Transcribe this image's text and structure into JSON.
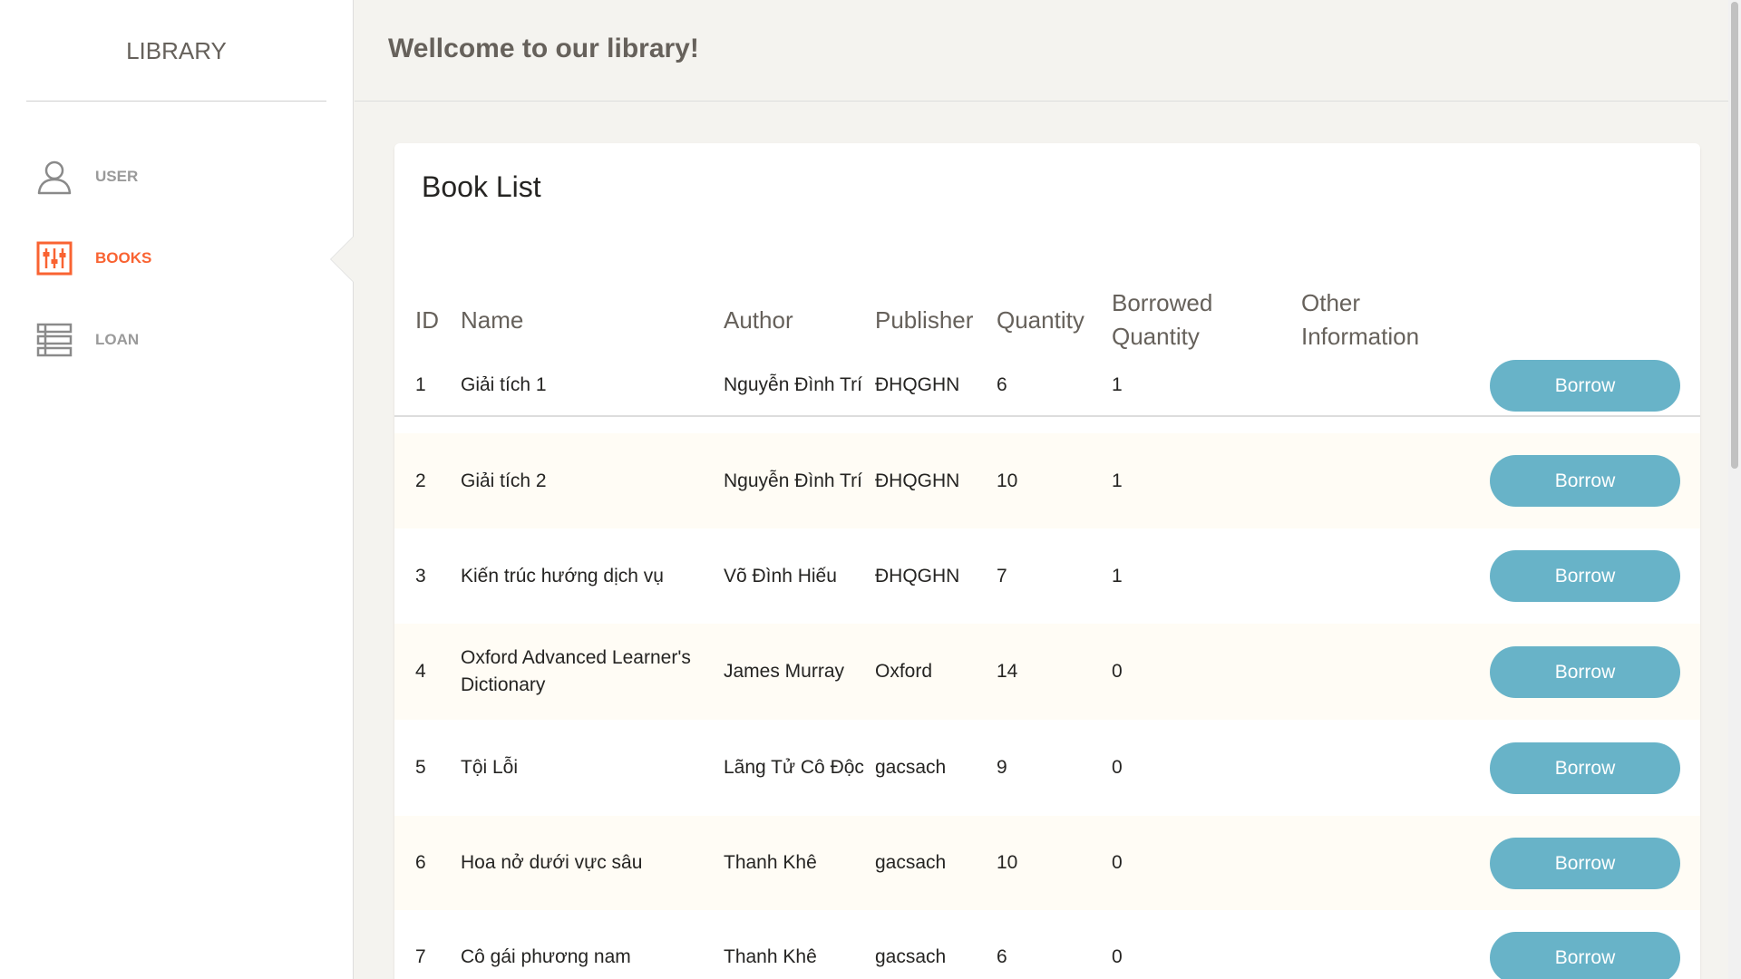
{
  "sidebar": {
    "brand": "LIBRARY",
    "items": [
      {
        "label": "USER",
        "icon": "user-icon",
        "active": false
      },
      {
        "label": "BOOKS",
        "icon": "books-icon",
        "active": true
      },
      {
        "label": "LOAN",
        "icon": "loan-icon",
        "active": false
      }
    ]
  },
  "header": {
    "title": "Wellcome to our library!"
  },
  "book_list": {
    "title": "Book List",
    "columns": [
      "ID",
      "Name",
      "Author",
      "Publisher",
      "Quantity",
      "Borrowed Quantity",
      "Other Information"
    ],
    "action_label": "Borrow",
    "rows": [
      {
        "id": "1",
        "name": "Giải tích 1",
        "author": "Nguyễn Đình Trí",
        "publisher": "ĐHQGHN",
        "quantity": "6",
        "borrowed": "1",
        "other": ""
      },
      {
        "id": "2",
        "name": "Giải tích 2",
        "author": "Nguyễn Đình Trí",
        "publisher": "ĐHQGHN",
        "quantity": "10",
        "borrowed": "1",
        "other": ""
      },
      {
        "id": "3",
        "name": "Kiến trúc hướng dịch vụ",
        "author": "Võ Đình Hiếu",
        "publisher": "ĐHQGHN",
        "quantity": "7",
        "borrowed": "1",
        "other": ""
      },
      {
        "id": "4",
        "name": "Oxford Advanced Learner's Dictionary",
        "author": "James Murray",
        "publisher": "Oxford",
        "quantity": "14",
        "borrowed": "0",
        "other": ""
      },
      {
        "id": "5",
        "name": "Tội Lỗi",
        "author": "Lãng Tử Cô Độc",
        "publisher": "gacsach",
        "quantity": "9",
        "borrowed": "0",
        "other": ""
      },
      {
        "id": "6",
        "name": "Hoa nở dưới vực sâu",
        "author": "Thanh Khê",
        "publisher": "gacsach",
        "quantity": "10",
        "borrowed": "0",
        "other": ""
      },
      {
        "id": "7",
        "name": "Cô gái phương nam",
        "author": "Thanh Khê",
        "publisher": "gacsach",
        "quantity": "6",
        "borrowed": "0",
        "other": ""
      }
    ]
  },
  "colors": {
    "accent": "#f96332",
    "button": "#68b3c8",
    "background": "#f4f3ef",
    "row_alt": "#fffcf5"
  }
}
